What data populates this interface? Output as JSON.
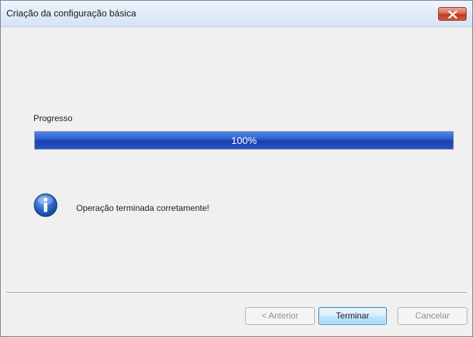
{
  "window": {
    "title": "Criação da configuração básica"
  },
  "progress": {
    "label": "Progresso",
    "value_text": "100%",
    "value_fraction": 1.0
  },
  "message": {
    "icon": "info-icon",
    "text": "Operação terminada corretamente!"
  },
  "buttons": {
    "back": "< Anterior",
    "finish": "Terminar",
    "cancel": "Cancelar"
  },
  "colors": {
    "progress_fill": "#2e62cf",
    "close_button": "#c0391e",
    "info_icon": "#1f5ab8"
  }
}
